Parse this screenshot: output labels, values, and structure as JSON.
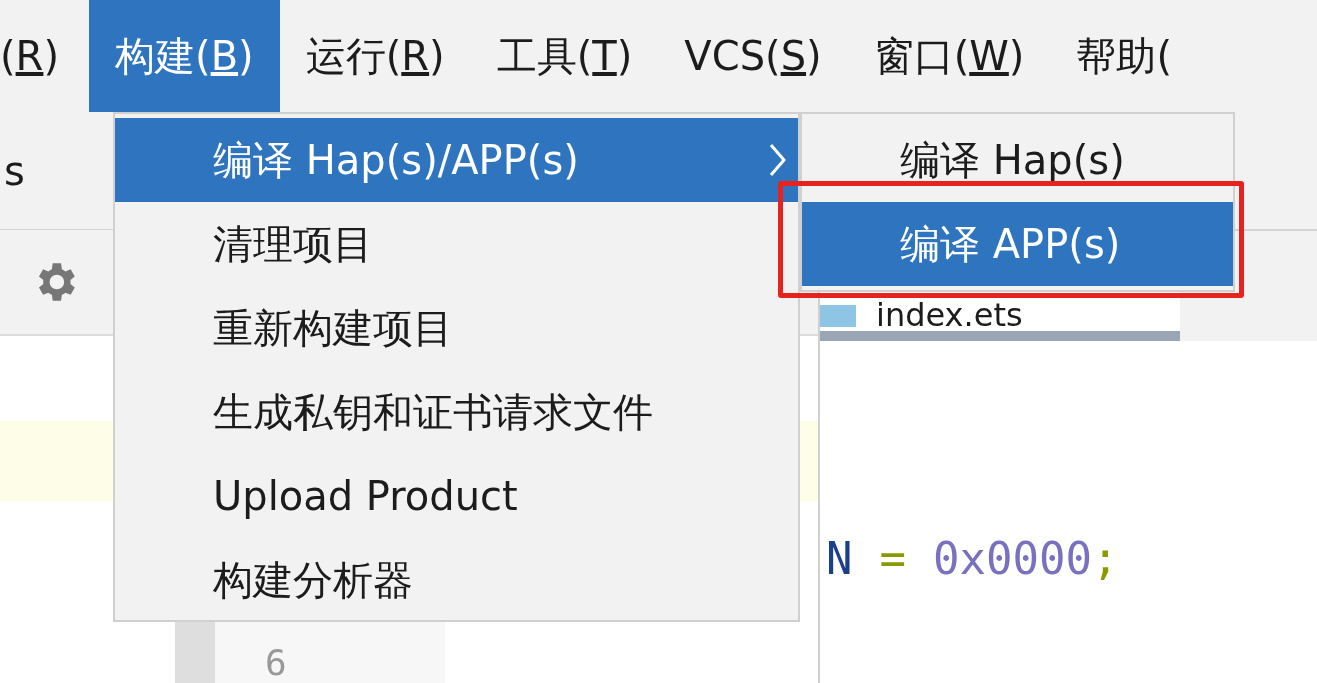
{
  "menubar": [
    {
      "pre": "(",
      "key": "R",
      "post": ")",
      "selected": false
    },
    {
      "pre": "构建(",
      "key": "B",
      "post": ")",
      "selected": true
    },
    {
      "pre": "运行(",
      "key": "R",
      "post": ")",
      "selected": false
    },
    {
      "pre": "工具(",
      "key": "T",
      "post": ")",
      "selected": false
    },
    {
      "pre": "VCS(",
      "key": "S",
      "post": ")",
      "selected": false
    },
    {
      "pre": "窗口(",
      "key": "W",
      "post": ")",
      "selected": false
    },
    {
      "pre": "帮助(",
      "selected": false
    }
  ],
  "build_menu": [
    {
      "label": "编译 Hap(s)/APP(s)",
      "selected": true,
      "has_submenu": true
    },
    {
      "label": "清理项目",
      "selected": false,
      "has_submenu": false
    },
    {
      "label": "重新构建项目",
      "selected": false,
      "has_submenu": false
    },
    {
      "label": "生成私钥和证书请求文件",
      "selected": false,
      "has_submenu": false
    },
    {
      "label": "Upload Product",
      "selected": false,
      "has_submenu": false
    },
    {
      "label": "构建分析器",
      "selected": false,
      "has_submenu": false
    }
  ],
  "submenu": [
    {
      "label": "编译 Hap(s)",
      "selected": false
    },
    {
      "label": "编译 APP(s)",
      "selected": true
    }
  ],
  "left_panel": {
    "tab_label": "s"
  },
  "editor_tab": {
    "title": "index.ets"
  },
  "code": [
    {
      "text": "N",
      "kind": "name"
    },
    {
      "text": "=",
      "kind": "op"
    },
    {
      "text": "0x0000",
      "kind": "number"
    },
    {
      "text": ";",
      "kind": "punct"
    }
  ],
  "gutter": {
    "line_number": "6"
  }
}
